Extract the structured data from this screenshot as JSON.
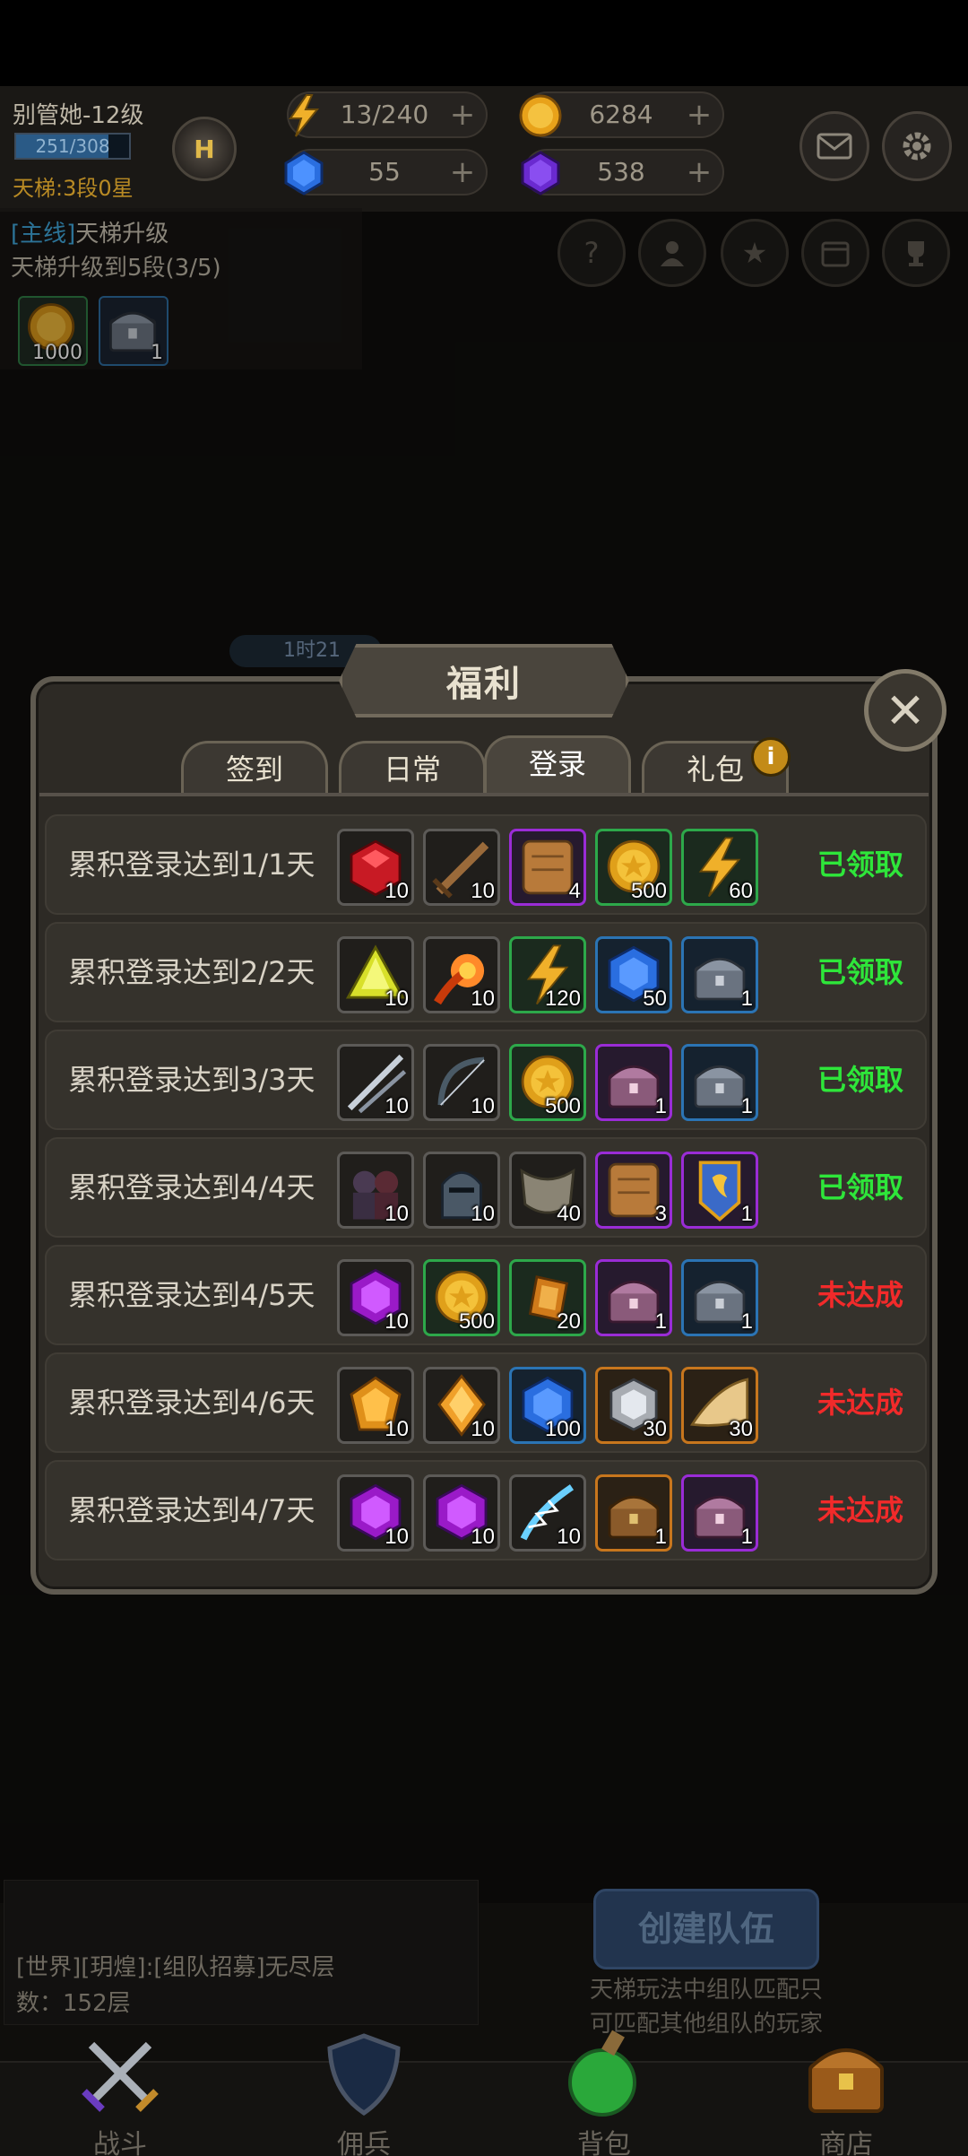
{
  "player": {
    "name": "别管她-12级",
    "exp_text": "251/308",
    "exp_progress": 0.815,
    "ladder_rank": "天梯:3段0星",
    "badge_letter": "H"
  },
  "resources": {
    "energy": "13/240",
    "gold": "6284",
    "blue_gem": "55",
    "purple_gem": "538"
  },
  "quest": {
    "tag": "[主线]",
    "title": "天梯升级",
    "desc": "天梯升级到5段(3/5)",
    "rewards": [
      {
        "icon": "gold-coin",
        "count": "1000"
      },
      {
        "icon": "iron-chest",
        "count": "1"
      }
    ]
  },
  "timer": "1时21",
  "modal": {
    "title": "福利",
    "close_label": "✕",
    "info_label": "i",
    "tabs": [
      {
        "label": "签到",
        "active": false
      },
      {
        "label": "日常",
        "active": false
      },
      {
        "label": "登录",
        "active": true
      },
      {
        "label": "礼包",
        "active": false
      }
    ],
    "rows": [
      {
        "label": "累积登录达到1/1天",
        "status": "已领取",
        "done": true,
        "items": [
          {
            "icon": "red-gem",
            "rarity": "gray",
            "count": "10"
          },
          {
            "icon": "wooden-sword",
            "rarity": "gray",
            "count": "10"
          },
          {
            "icon": "leather-scroll",
            "rarity": "purple",
            "count": "4"
          },
          {
            "icon": "gold-coin",
            "rarity": "green",
            "count": "500"
          },
          {
            "icon": "lightning",
            "rarity": "green",
            "count": "60"
          }
        ]
      },
      {
        "label": "累积登录达到2/2天",
        "status": "已领取",
        "done": true,
        "items": [
          {
            "icon": "yellow-crystal",
            "rarity": "gray",
            "count": "10"
          },
          {
            "icon": "fire-orb",
            "rarity": "gray",
            "count": "10"
          },
          {
            "icon": "lightning",
            "rarity": "green",
            "count": "120"
          },
          {
            "icon": "blue-gem",
            "rarity": "blue",
            "count": "50"
          },
          {
            "icon": "iron-chest",
            "rarity": "blue",
            "count": "1"
          }
        ]
      },
      {
        "label": "累积登录达到3/3天",
        "status": "已领取",
        "done": true,
        "items": [
          {
            "icon": "steel-blades",
            "rarity": "gray",
            "count": "10"
          },
          {
            "icon": "bow",
            "rarity": "gray",
            "count": "10"
          },
          {
            "icon": "gold-coin",
            "rarity": "green",
            "count": "500"
          },
          {
            "icon": "purple-chest",
            "rarity": "purple",
            "count": "1"
          },
          {
            "icon": "iron-chest",
            "rarity": "blue",
            "count": "1"
          }
        ]
      },
      {
        "label": "累积登录达到4/4天",
        "status": "已领取",
        "done": true,
        "items": [
          {
            "icon": "hooded-figures",
            "rarity": "gray",
            "count": "10"
          },
          {
            "icon": "knight-helmet",
            "rarity": "gray",
            "count": "10"
          },
          {
            "icon": "cloth-scarf",
            "rarity": "gray",
            "count": "40"
          },
          {
            "icon": "leather-scroll",
            "rarity": "purple",
            "count": "3"
          },
          {
            "icon": "guild-banner",
            "rarity": "purple",
            "count": "1"
          }
        ]
      },
      {
        "label": "累积登录达到4/5天",
        "status": "未达成",
        "done": false,
        "items": [
          {
            "icon": "purple-gem",
            "rarity": "gray",
            "count": "10"
          },
          {
            "icon": "gold-coin",
            "rarity": "green",
            "count": "500"
          },
          {
            "icon": "amber-shard",
            "rarity": "green",
            "count": "20"
          },
          {
            "icon": "purple-chest",
            "rarity": "purple",
            "count": "1"
          },
          {
            "icon": "iron-chest",
            "rarity": "blue",
            "count": "1"
          }
        ]
      },
      {
        "label": "累积登录达到4/6天",
        "status": "未达成",
        "done": false,
        "items": [
          {
            "icon": "orange-gem",
            "rarity": "gray",
            "count": "10"
          },
          {
            "icon": "orange-diamond",
            "rarity": "gray",
            "count": "10"
          },
          {
            "icon": "blue-gem",
            "rarity": "blue",
            "count": "100"
          },
          {
            "icon": "silver-gem",
            "rarity": "orange",
            "count": "30"
          },
          {
            "icon": "gold-cloth",
            "rarity": "orange",
            "count": "30"
          }
        ]
      },
      {
        "label": "累积登录达到4/7天",
        "status": "未达成",
        "done": false,
        "items": [
          {
            "icon": "purple-gem",
            "rarity": "gray",
            "count": "10"
          },
          {
            "icon": "purple-gem",
            "rarity": "gray",
            "count": "10"
          },
          {
            "icon": "lightning-feather",
            "rarity": "gray",
            "count": "10"
          },
          {
            "icon": "wooden-chest",
            "rarity": "orange",
            "count": "1"
          },
          {
            "icon": "purple-chest",
            "rarity": "purple",
            "count": "1"
          }
        ]
      }
    ]
  },
  "chat": {
    "line1": "[世界][玥煌]:[组队招募]无尽层",
    "line2": "数：152层"
  },
  "team": {
    "create_label": "创建队伍",
    "hint_line1": "天梯玩法中组队匹配只",
    "hint_line2": "可匹配其他组队的玩家"
  },
  "nav": [
    {
      "label": "战斗",
      "icon": "crossed-swords-icon"
    },
    {
      "label": "佣兵",
      "icon": "shield-icon"
    },
    {
      "label": "背包",
      "icon": "potion-icon"
    },
    {
      "label": "商店",
      "icon": "treasure-chest-icon"
    }
  ],
  "colors": {
    "claimed": "#2ee63a",
    "not_reached": "#f22a2a",
    "rarity_green": "#2da84a",
    "rarity_blue": "#2b74b4",
    "rarity_purple": "#9a2cd6",
    "rarity_orange": "#c7761d"
  }
}
